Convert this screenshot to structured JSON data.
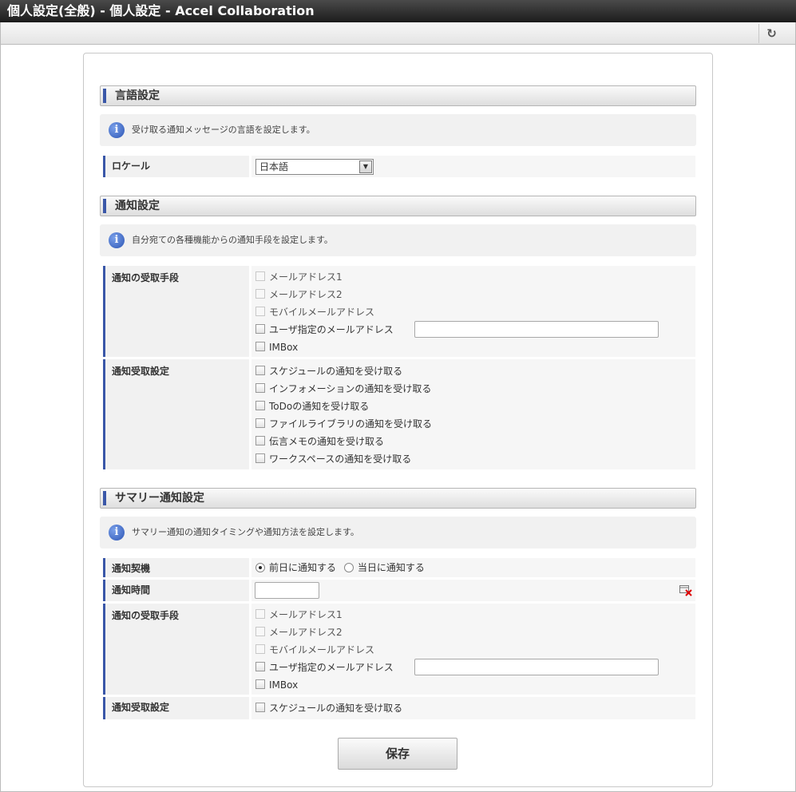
{
  "window": {
    "title": "個人設定(全般) - 個人設定 - Accel Collaboration",
    "reload_icon": "refresh-icon"
  },
  "language": {
    "header": "言語設定",
    "info": "受け取る通知メッセージの言語を設定します。",
    "locale_label": "ロケール",
    "locale_value": "日本語"
  },
  "notification": {
    "header": "通知設定",
    "info": "自分宛ての各種機能からの通知手段を設定します。",
    "method_label": "通知の受取手段",
    "methods": [
      "メールアドレス1",
      "メールアドレス2",
      "モバイルメールアドレス",
      "ユーザ指定のメールアドレス",
      "IMBox"
    ],
    "receive_label": "通知受取設定",
    "receive": [
      "スケジュールの通知を受け取る",
      "インフォメーションの通知を受け取る",
      "ToDoの通知を受け取る",
      "ファイルライブラリの通知を受け取る",
      "伝言メモの通知を受け取る",
      "ワークスペースの通知を受け取る"
    ]
  },
  "summary": {
    "header": "サマリー通知設定",
    "info": "サマリー通知の通知タイミングや通知方法を設定します。",
    "trigger_label": "通知契機",
    "trigger_options": [
      "前日に通知する",
      "当日に通知する"
    ],
    "trigger_selected": "前日に通知する",
    "time_label": "通知時間",
    "time_value": "",
    "method_label": "通知の受取手段",
    "methods": [
      "メールアドレス1",
      "メールアドレス2",
      "モバイルメールアドレス",
      "ユーザ指定のメールアドレス",
      "IMBox"
    ],
    "receive_label": "通知受取設定",
    "receive": [
      "スケジュールの通知を受け取る"
    ]
  },
  "save_label": "保存"
}
